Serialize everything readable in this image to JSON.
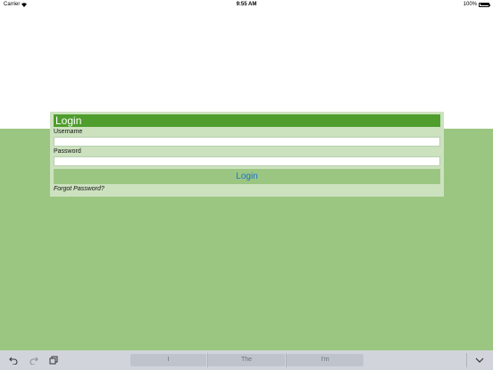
{
  "status_bar": {
    "carrier": "Carrier",
    "time": "9:55 AM",
    "battery": "100%",
    "wifi_icon": "wifi-icon",
    "battery_icon": "battery-icon"
  },
  "login": {
    "title": "Login",
    "username_label": "Username",
    "username_value": "",
    "password_label": "Password",
    "password_value": "",
    "button_label": "Login",
    "forgot_password": "Forgot Password?"
  },
  "keyboard": {
    "icons": [
      "undo-icon",
      "redo-icon",
      "paste-icon",
      "dismiss-keyboard-icon"
    ],
    "suggestions": [
      "I",
      "The",
      "I'm"
    ]
  },
  "colors": {
    "header_green": "#4f9d2d",
    "panel_green": "#cce2bf",
    "background_green": "#9bc682",
    "button_text_blue": "#1e73c8"
  }
}
